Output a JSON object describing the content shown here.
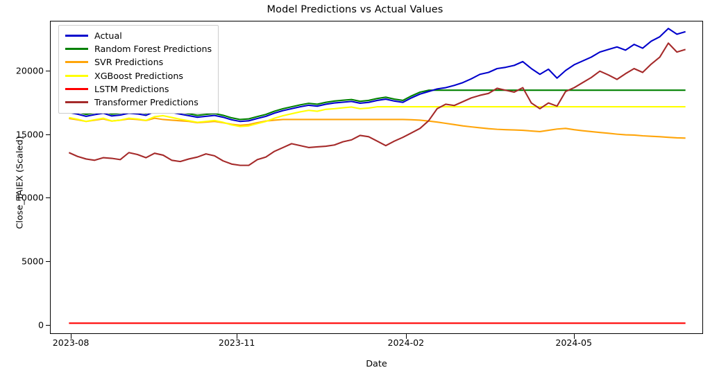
{
  "chart_data": {
    "type": "line",
    "title": "Model Predictions vs Actual Values",
    "xlabel": "Date",
    "ylabel": "Close_TAIEX (Scaled)",
    "grid": false,
    "legend_position": "upper left",
    "xlim": [
      "2023-07-27",
      "2024-07-05"
    ],
    "ylim": [
      -700,
      23900
    ],
    "yticks": [
      0,
      5000,
      10000,
      15000,
      20000
    ],
    "ytick_labels": [
      "0",
      "5000",
      "10000",
      "15000",
      "20000"
    ],
    "xticks": [
      "2023-08",
      "2023-11",
      "2024-02",
      "2024-05"
    ],
    "xtick_positions": [
      0.032,
      0.286,
      0.545,
      0.802
    ],
    "x": [
      "2023-08-01",
      "2023-08-04",
      "2023-08-09",
      "2023-08-14",
      "2023-08-18",
      "2023-08-23",
      "2023-08-28",
      "2023-09-01",
      "2023-09-06",
      "2023-09-11",
      "2023-09-15",
      "2023-09-20",
      "2023-09-25",
      "2023-09-29",
      "2023-10-04",
      "2023-10-09",
      "2023-10-13",
      "2023-10-18",
      "2023-10-23",
      "2023-10-27",
      "2023-11-01",
      "2023-11-06",
      "2023-11-10",
      "2023-11-15",
      "2023-11-20",
      "2023-11-24",
      "2023-11-29",
      "2023-12-04",
      "2023-12-08",
      "2023-12-13",
      "2023-12-18",
      "2023-12-22",
      "2023-12-27",
      "2024-01-02",
      "2024-01-05",
      "2024-01-10",
      "2024-01-15",
      "2024-01-19",
      "2024-01-24",
      "2024-01-29",
      "2024-02-02",
      "2024-02-07",
      "2024-02-16",
      "2024-02-21",
      "2024-02-26",
      "2024-03-01",
      "2024-03-06",
      "2024-03-11",
      "2024-03-15",
      "2024-03-20",
      "2024-03-25",
      "2024-03-29",
      "2024-04-03",
      "2024-04-09",
      "2024-04-12",
      "2024-04-17",
      "2024-04-22",
      "2024-04-26",
      "2024-05-02",
      "2024-05-07",
      "2024-05-10",
      "2024-05-15",
      "2024-05-20",
      "2024-05-24",
      "2024-05-29",
      "2024-06-03",
      "2024-06-07",
      "2024-06-12",
      "2024-06-17",
      "2024-06-21",
      "2024-06-26",
      "2024-07-01",
      "2024-07-05"
    ],
    "series": [
      {
        "name": "Actual",
        "color": "#0000CC",
        "linewidth": 2.1,
        "zorder": 6,
        "values": [
          16750,
          16620,
          16450,
          16580,
          16700,
          16480,
          16550,
          16700,
          16640,
          16530,
          16820,
          16900,
          16760,
          16620,
          16500,
          16380,
          16450,
          16520,
          16380,
          16180,
          16050,
          16100,
          16280,
          16450,
          16700,
          16900,
          17050,
          17200,
          17320,
          17250,
          17400,
          17500,
          17560,
          17620,
          17480,
          17550,
          17700,
          17800,
          17650,
          17550,
          17900,
          18200,
          18400,
          18600,
          18700,
          18880,
          19100,
          19400,
          19750,
          19900,
          20200,
          20300,
          20450,
          20750,
          20200,
          19750,
          20150,
          19450,
          20050,
          20500,
          20800,
          21100,
          21500,
          21700,
          21900,
          21650,
          22100,
          21800,
          22350,
          22700,
          23350,
          22900,
          23100
        ]
      },
      {
        "name": "Random Forest Predictions",
        "color": "#008000",
        "linewidth": 2.1,
        "zorder": 5,
        "values": [
          16900,
          16780,
          16600,
          16720,
          16850,
          16620,
          16700,
          16850,
          16790,
          16680,
          16970,
          17050,
          16910,
          16770,
          16650,
          16530,
          16600,
          16670,
          16530,
          16330,
          16200,
          16250,
          16430,
          16600,
          16850,
          17050,
          17200,
          17350,
          17470,
          17400,
          17550,
          17650,
          17710,
          17770,
          17630,
          17700,
          17850,
          17950,
          17800,
          17700,
          18050,
          18350,
          18500,
          18500,
          18500,
          18500,
          18500,
          18500,
          18500,
          18500,
          18500,
          18500,
          18500,
          18500,
          18500,
          18500,
          18500,
          18500,
          18500,
          18500,
          18500,
          18500,
          18500,
          18500,
          18500,
          18500,
          18500,
          18500,
          18500,
          18500,
          18500,
          18500,
          18500
        ]
      },
      {
        "name": "SVR Predictions",
        "color": "#FFA50A",
        "linewidth": 2.1,
        "zorder": 3,
        "values": [
          16280,
          16180,
          16050,
          16150,
          16250,
          16080,
          16150,
          16250,
          16200,
          16120,
          16300,
          16200,
          16150,
          16100,
          16050,
          15950,
          16000,
          16050,
          15950,
          15820,
          15750,
          15800,
          15950,
          16080,
          16150,
          16200,
          16200,
          16200,
          16200,
          16200,
          16200,
          16200,
          16200,
          16200,
          16200,
          16200,
          16200,
          16200,
          16200,
          16200,
          16180,
          16150,
          16080,
          16000,
          15900,
          15800,
          15700,
          15620,
          15550,
          15480,
          15430,
          15400,
          15380,
          15350,
          15300,
          15250,
          15350,
          15450,
          15500,
          15400,
          15320,
          15250,
          15180,
          15120,
          15050,
          15000,
          14980,
          14920,
          14880,
          14850,
          14800,
          14760,
          14740
        ]
      },
      {
        "name": "XGBoost Predictions",
        "color": "#FFFF00",
        "linewidth": 2.1,
        "zorder": 4,
        "values": [
          16350,
          16220,
          16050,
          16180,
          16300,
          16080,
          16150,
          16300,
          16240,
          16130,
          16420,
          16500,
          16360,
          16220,
          16100,
          15980,
          16050,
          16120,
          15980,
          15780,
          15650,
          15700,
          15880,
          16050,
          16300,
          16500,
          16650,
          16800,
          16920,
          16850,
          17000,
          17050,
          17120,
          17180,
          17050,
          17100,
          17200,
          17200,
          17200,
          17200,
          17200,
          17200,
          17200,
          17200,
          17200,
          17200,
          17200,
          17200,
          17200,
          17200,
          17200,
          17200,
          17200,
          17200,
          17200,
          17200,
          17200,
          17200,
          17200,
          17200,
          17200,
          17200,
          17200,
          17200,
          17200,
          17200,
          17200,
          17200,
          17200,
          17200,
          17200,
          17200,
          17200
        ]
      },
      {
        "name": "LSTM Predictions",
        "color": "#FF0000",
        "linewidth": 2.1,
        "zorder": 2,
        "values": [
          200,
          200,
          200,
          200,
          200,
          200,
          200,
          200,
          200,
          200,
          200,
          200,
          200,
          200,
          200,
          200,
          200,
          200,
          200,
          200,
          200,
          200,
          200,
          200,
          200,
          200,
          200,
          200,
          200,
          200,
          200,
          200,
          200,
          200,
          200,
          200,
          200,
          200,
          200,
          200,
          200,
          200,
          200,
          200,
          200,
          200,
          200,
          200,
          200,
          200,
          200,
          200,
          200,
          200,
          200,
          200,
          200,
          200,
          200,
          200,
          200,
          200,
          200,
          200,
          200,
          200,
          200,
          200,
          200,
          200,
          200,
          200,
          200
        ]
      },
      {
        "name": "Transformer Predictions",
        "color": "#A52A2A",
        "linewidth": 2.1,
        "zorder": 5,
        "values": [
          13600,
          13300,
          13100,
          13000,
          13200,
          13150,
          13050,
          13600,
          13450,
          13200,
          13550,
          13400,
          13000,
          12900,
          13100,
          13250,
          13500,
          13350,
          12950,
          12700,
          12600,
          12600,
          13050,
          13250,
          13700,
          14000,
          14300,
          14150,
          14000,
          14050,
          14100,
          14200,
          14450,
          14600,
          14950,
          14850,
          14500,
          14150,
          14500,
          14800,
          15150,
          15500,
          16100,
          17050,
          17400,
          17300,
          17600,
          17900,
          18100,
          18250,
          18650,
          18500,
          18350,
          18700,
          17500,
          17050,
          17500,
          17250,
          18400,
          18700,
          19100,
          19500,
          20000,
          19700,
          19350,
          19800,
          20200,
          19900,
          20550,
          21100,
          22200,
          21500,
          21700
        ]
      }
    ]
  },
  "legend": {
    "items": [
      {
        "label": "Actual",
        "color": "#0000CC"
      },
      {
        "label": "Random Forest Predictions",
        "color": "#008000"
      },
      {
        "label": "SVR Predictions",
        "color": "#FFA50A"
      },
      {
        "label": "XGBoost Predictions",
        "color": "#FFFF00"
      },
      {
        "label": "LSTM Predictions",
        "color": "#FF0000"
      },
      {
        "label": "Transformer Predictions",
        "color": "#A52A2A"
      }
    ]
  }
}
